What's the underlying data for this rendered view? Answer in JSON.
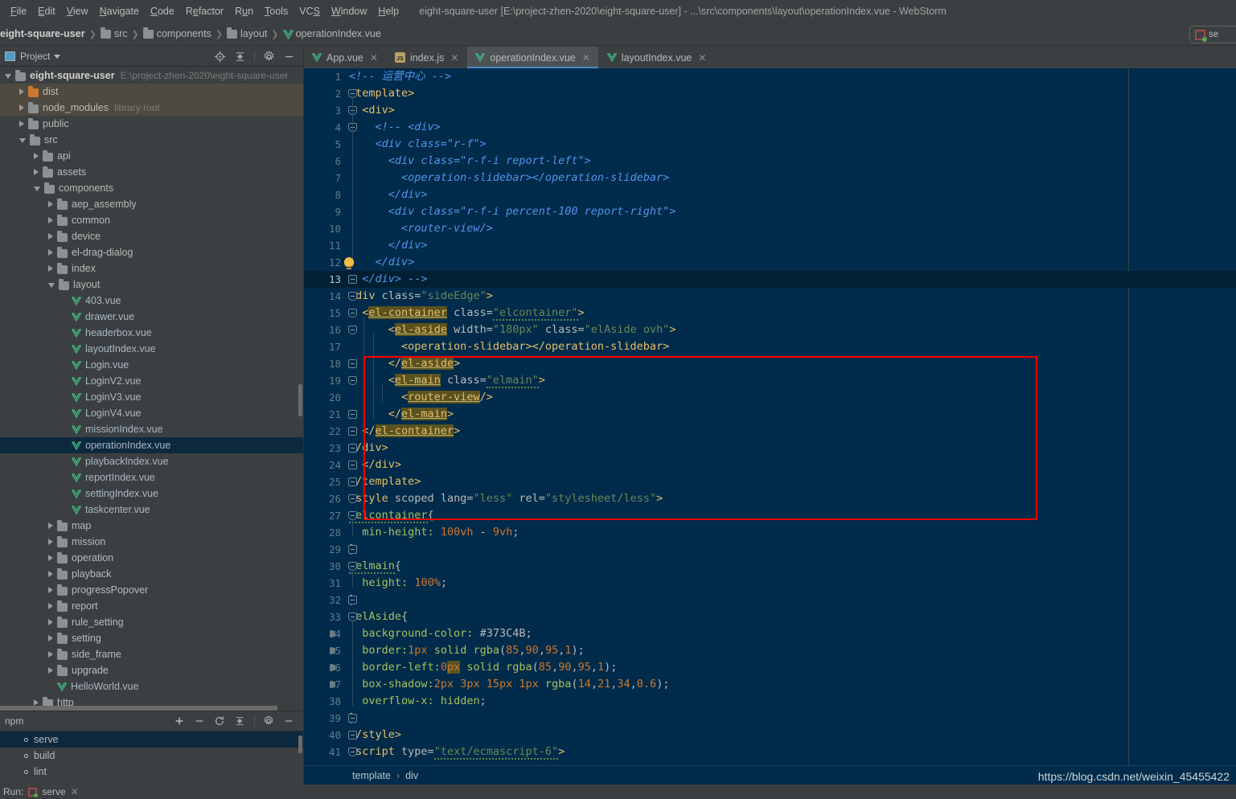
{
  "window": {
    "title": "eight-square-user [E:\\project-zhen-2020\\eight-square-user] - ...\\src\\components\\layout\\operationIndex.vue - WebStorm"
  },
  "menubar": {
    "items": [
      "File",
      "Edit",
      "View",
      "Navigate",
      "Code",
      "Refactor",
      "Run",
      "Tools",
      "VCS",
      "Window",
      "Help"
    ]
  },
  "breadcrumb": {
    "items": [
      {
        "label": "eight-square-user",
        "icon": "none"
      },
      {
        "label": "src",
        "icon": "folder-icon"
      },
      {
        "label": "components",
        "icon": "folder-icon"
      },
      {
        "label": "layout",
        "icon": "folder-icon"
      },
      {
        "label": "operationIndex.vue",
        "icon": "vue-file-icon"
      }
    ]
  },
  "run_config": {
    "label": "se"
  },
  "project_panel": {
    "title": "Project",
    "tools": [
      "locate-icon",
      "collapse-all-icon",
      "gear-icon",
      "minimize-icon"
    ],
    "tree": [
      {
        "label": "eight-square-user",
        "sub": "E:\\project-zhen-2020\\eight-square-user",
        "depth": 0,
        "icon": "folder-icon",
        "arrow": "open",
        "bold": true,
        "state": "none"
      },
      {
        "label": "dist",
        "sub": "",
        "depth": 1,
        "icon": "folder-orange-icon",
        "arrow": "closed",
        "bold": false,
        "state": "brown"
      },
      {
        "label": "node_modules",
        "sub": "library root",
        "depth": 1,
        "icon": "folder-icon",
        "arrow": "closed",
        "bold": false,
        "state": "brown"
      },
      {
        "label": "public",
        "sub": "",
        "depth": 1,
        "icon": "folder-icon",
        "arrow": "closed",
        "bold": false,
        "state": "none"
      },
      {
        "label": "src",
        "sub": "",
        "depth": 1,
        "icon": "folder-icon",
        "arrow": "open",
        "bold": false,
        "state": "none"
      },
      {
        "label": "api",
        "sub": "",
        "depth": 2,
        "icon": "folder-icon",
        "arrow": "closed",
        "bold": false,
        "state": "none"
      },
      {
        "label": "assets",
        "sub": "",
        "depth": 2,
        "icon": "folder-icon",
        "arrow": "closed",
        "bold": false,
        "state": "none"
      },
      {
        "label": "components",
        "sub": "",
        "depth": 2,
        "icon": "folder-icon",
        "arrow": "open",
        "bold": false,
        "state": "none"
      },
      {
        "label": "aep_assembly",
        "sub": "",
        "depth": 3,
        "icon": "folder-icon",
        "arrow": "closed",
        "bold": false,
        "state": "none"
      },
      {
        "label": "common",
        "sub": "",
        "depth": 3,
        "icon": "folder-icon",
        "arrow": "closed",
        "bold": false,
        "state": "none"
      },
      {
        "label": "device",
        "sub": "",
        "depth": 3,
        "icon": "folder-icon",
        "arrow": "closed",
        "bold": false,
        "state": "none"
      },
      {
        "label": "el-drag-dialog",
        "sub": "",
        "depth": 3,
        "icon": "folder-icon",
        "arrow": "closed",
        "bold": false,
        "state": "none"
      },
      {
        "label": "index",
        "sub": "",
        "depth": 3,
        "icon": "folder-icon",
        "arrow": "closed",
        "bold": false,
        "state": "none"
      },
      {
        "label": "layout",
        "sub": "",
        "depth": 3,
        "icon": "folder-icon",
        "arrow": "open",
        "bold": false,
        "state": "none"
      },
      {
        "label": "403.vue",
        "sub": "",
        "depth": 4,
        "icon": "vue-file-icon",
        "arrow": "none",
        "bold": false,
        "state": "none"
      },
      {
        "label": "drawer.vue",
        "sub": "",
        "depth": 4,
        "icon": "vue-file-icon",
        "arrow": "none",
        "bold": false,
        "state": "none"
      },
      {
        "label": "headerbox.vue",
        "sub": "",
        "depth": 4,
        "icon": "vue-file-icon",
        "arrow": "none",
        "bold": false,
        "state": "none"
      },
      {
        "label": "layoutIndex.vue",
        "sub": "",
        "depth": 4,
        "icon": "vue-file-icon",
        "arrow": "none",
        "bold": false,
        "state": "none"
      },
      {
        "label": "Login.vue",
        "sub": "",
        "depth": 4,
        "icon": "vue-file-icon",
        "arrow": "none",
        "bold": false,
        "state": "none"
      },
      {
        "label": "LoginV2.vue",
        "sub": "",
        "depth": 4,
        "icon": "vue-file-icon",
        "arrow": "none",
        "bold": false,
        "state": "none"
      },
      {
        "label": "LoginV3.vue",
        "sub": "",
        "depth": 4,
        "icon": "vue-file-icon",
        "arrow": "none",
        "bold": false,
        "state": "none"
      },
      {
        "label": "LoginV4.vue",
        "sub": "",
        "depth": 4,
        "icon": "vue-file-icon",
        "arrow": "none",
        "bold": false,
        "state": "none"
      },
      {
        "label": "missionIndex.vue",
        "sub": "",
        "depth": 4,
        "icon": "vue-file-icon",
        "arrow": "none",
        "bold": false,
        "state": "none"
      },
      {
        "label": "operationIndex.vue",
        "sub": "",
        "depth": 4,
        "icon": "vue-file-icon",
        "arrow": "none",
        "bold": false,
        "state": "blue"
      },
      {
        "label": "playbackIndex.vue",
        "sub": "",
        "depth": 4,
        "icon": "vue-file-icon",
        "arrow": "none",
        "bold": false,
        "state": "none"
      },
      {
        "label": "reportIndex.vue",
        "sub": "",
        "depth": 4,
        "icon": "vue-file-icon",
        "arrow": "none",
        "bold": false,
        "state": "none"
      },
      {
        "label": "settingIndex.vue",
        "sub": "",
        "depth": 4,
        "icon": "vue-file-icon",
        "arrow": "none",
        "bold": false,
        "state": "none"
      },
      {
        "label": "taskcenter.vue",
        "sub": "",
        "depth": 4,
        "icon": "vue-file-icon",
        "arrow": "none",
        "bold": false,
        "state": "none"
      },
      {
        "label": "map",
        "sub": "",
        "depth": 3,
        "icon": "folder-icon",
        "arrow": "closed",
        "bold": false,
        "state": "none"
      },
      {
        "label": "mission",
        "sub": "",
        "depth": 3,
        "icon": "folder-icon",
        "arrow": "closed",
        "bold": false,
        "state": "none"
      },
      {
        "label": "operation",
        "sub": "",
        "depth": 3,
        "icon": "folder-icon",
        "arrow": "closed",
        "bold": false,
        "state": "none"
      },
      {
        "label": "playback",
        "sub": "",
        "depth": 3,
        "icon": "folder-icon",
        "arrow": "closed",
        "bold": false,
        "state": "none"
      },
      {
        "label": "progressPopover",
        "sub": "",
        "depth": 3,
        "icon": "folder-icon",
        "arrow": "closed",
        "bold": false,
        "state": "none"
      },
      {
        "label": "report",
        "sub": "",
        "depth": 3,
        "icon": "folder-icon",
        "arrow": "closed",
        "bold": false,
        "state": "none"
      },
      {
        "label": "rule_setting",
        "sub": "",
        "depth": 3,
        "icon": "folder-icon",
        "arrow": "closed",
        "bold": false,
        "state": "none"
      },
      {
        "label": "setting",
        "sub": "",
        "depth": 3,
        "icon": "folder-icon",
        "arrow": "closed",
        "bold": false,
        "state": "none"
      },
      {
        "label": "side_frame",
        "sub": "",
        "depth": 3,
        "icon": "folder-icon",
        "arrow": "closed",
        "bold": false,
        "state": "none"
      },
      {
        "label": "upgrade",
        "sub": "",
        "depth": 3,
        "icon": "folder-icon",
        "arrow": "closed",
        "bold": false,
        "state": "none"
      },
      {
        "label": "HelloWorld.vue",
        "sub": "",
        "depth": 3,
        "icon": "vue-file-icon",
        "arrow": "none",
        "bold": false,
        "state": "none"
      },
      {
        "label": "http",
        "sub": "",
        "depth": 2,
        "icon": "folder-icon",
        "arrow": "closed",
        "bold": false,
        "state": "none"
      }
    ]
  },
  "npm_panel": {
    "title": "npm",
    "tools": [
      "add-icon",
      "remove-icon",
      "refresh-icon",
      "collapse-all-icon",
      "gear-icon",
      "minimize-icon"
    ],
    "scripts": [
      {
        "label": "serve",
        "selected": true
      },
      {
        "label": "build",
        "selected": false
      },
      {
        "label": "lint",
        "selected": false
      }
    ]
  },
  "run_bar": {
    "label": "Run:",
    "config": "serve"
  },
  "tabs": [
    {
      "label": "App.vue",
      "icon": "vue-file-icon",
      "active": false
    },
    {
      "label": "index.js",
      "icon": "js-file-icon",
      "active": false
    },
    {
      "label": "operationIndex.vue",
      "icon": "vue-file-icon",
      "active": true
    },
    {
      "label": "layoutIndex.vue",
      "icon": "vue-file-icon",
      "active": false
    }
  ],
  "editor": {
    "current_line": 13,
    "lines": [
      {
        "n": 1,
        "text": "    <!-- 运营中心 -->"
      },
      {
        "n": 2,
        "text": "  <template>"
      },
      {
        "n": 3,
        "text": "    <div>"
      },
      {
        "n": 4,
        "text": "        <!-- <div>"
      },
      {
        "n": 5,
        "text": "      <div class=\"r-f\">"
      },
      {
        "n": 6,
        "text": "        <div class=\"r-f-i report-left\">"
      },
      {
        "n": 7,
        "text": "          <operation-slidebar></operation-slidebar>"
      },
      {
        "n": 8,
        "text": "        </div>"
      },
      {
        "n": 9,
        "text": "        <div class=\"r-f-i percent-100 report-right\">"
      },
      {
        "n": 10,
        "text": "          <router-view/>"
      },
      {
        "n": 11,
        "text": "        </div>"
      },
      {
        "n": 12,
        "text": "      </div>"
      },
      {
        "n": 13,
        "text": "    </div> -->"
      },
      {
        "n": 14,
        "text": "  <div class=\"sideEdge\">"
      },
      {
        "n": 15,
        "text": "    <el-container class=\"elcontainer\">"
      },
      {
        "n": 16,
        "text": "        <el-aside width=\"180px\" class=\"elAside ovh\">"
      },
      {
        "n": 17,
        "text": "          <operation-slidebar></operation-slidebar>"
      },
      {
        "n": 18,
        "text": "        </el-aside>"
      },
      {
        "n": 19,
        "text": "        <el-main class=\"elmain\">"
      },
      {
        "n": 20,
        "text": "          <router-view/>"
      },
      {
        "n": 21,
        "text": "        </el-main>"
      },
      {
        "n": 22,
        "text": "    </el-container>"
      },
      {
        "n": 23,
        "text": "  </div>"
      },
      {
        "n": 24,
        "text": "    </div>"
      },
      {
        "n": 25,
        "text": "  </template>"
      },
      {
        "n": 26,
        "text": "  <style scoped lang=\"less\" rel=\"stylesheet/less\">"
      },
      {
        "n": 27,
        "text": "  .elcontainer{"
      },
      {
        "n": 28,
        "text": "    min-height: 100vh - 9vh;"
      },
      {
        "n": 29,
        "text": "  }"
      },
      {
        "n": 30,
        "text": "  .elmain{"
      },
      {
        "n": 31,
        "text": "    height: 100%;"
      },
      {
        "n": 32,
        "text": "  }"
      },
      {
        "n": 33,
        "text": "  .elAside{"
      },
      {
        "n": 34,
        "text": "    background-color: #373C4B;"
      },
      {
        "n": 35,
        "text": "    border:1px solid rgba(85,90,95,1);"
      },
      {
        "n": 36,
        "text": "    border-left:0px solid rgba(85,90,95,1);"
      },
      {
        "n": 37,
        "text": "    box-shadow:2px 3px 15px 1px rgba(14,21,34,0.6);"
      },
      {
        "n": 38,
        "text": "    overflow-x: hidden;"
      },
      {
        "n": 39,
        "text": "  }"
      },
      {
        "n": 40,
        "text": "  </style>"
      },
      {
        "n": 41,
        "text": "  <script type=\"text/ecmascript-6\">"
      }
    ]
  },
  "editor_breadcrumb": {
    "items": [
      "template",
      "div"
    ],
    "separator": "›"
  },
  "watermark": {
    "text": "https://blog.csdn.net/weixin_45455422"
  },
  "colors": {
    "editor_bg": "#002B4A",
    "panel_bg": "#3c3f41",
    "tag": "#e8bf6a",
    "string": "#6a8759",
    "comment": "#5394ec",
    "number": "#cc7832",
    "highlight_box": "#f40000",
    "selection_blue": "#0d293e",
    "selection_brown": "#4e4a3f",
    "accent_vue": "#42b883"
  }
}
